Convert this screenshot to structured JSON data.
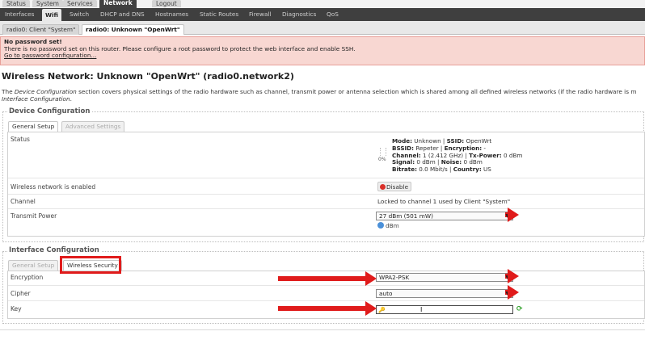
{
  "top_nav": [
    "Status",
    "System",
    "Services",
    "Network",
    "Logout"
  ],
  "sub_nav": [
    "Interfaces",
    "Wifi",
    "Switch",
    "DHCP and DNS",
    "Hostnames",
    "Static Routes",
    "Firewall",
    "Diagnostics",
    "QoS"
  ],
  "iface_tabs": [
    "radio0: Client \"System\"",
    "radio0: Unknown \"OpenWrt\""
  ],
  "alert": {
    "title": "No password set!",
    "message": "There is no password set on this router. Please configure a root password to protect the web interface and enable SSH.",
    "link": "Go to password configuration..."
  },
  "heading": "Wireless Network: Unknown \"OpenWrt\" (radio0.network2)",
  "description": {
    "prefix": "The ",
    "em1": "Device Configuration",
    "middle": " section covers physical settings of the radio hardware such as channel, transmit power or antenna selection which is shared among all defined wireless networks (if the radio hardware is m",
    "em2": "Interface Configuration",
    "suffix": "."
  },
  "device_config": {
    "legend": "Device Configuration",
    "tabs": [
      "General Setup",
      "Advanced Settings"
    ],
    "status_label": "Status",
    "signal_pct": "0%",
    "status": {
      "mode_k": "Mode:",
      "mode_v": " Unknown | ",
      "ssid_k": "SSID:",
      "ssid_v": " OpenWrt",
      "bssid_k": "BSSID:",
      "bssid_v": " Repeter | ",
      "enc_k": "Encryption:",
      "enc_v": " -",
      "chan_k": "Channel:",
      "chan_v": " 1 (2.412 GHz) | ",
      "tx_k": "Tx-Power:",
      "tx_v": " 0 dBm",
      "sig_k": "Signal:",
      "sig_v": " 0 dBm | ",
      "noise_k": "Noise:",
      "noise_v": " 0 dBm",
      "bit_k": "Bitrate:",
      "bit_v": " 0.0 Mbit/s | ",
      "country_k": "Country:",
      "country_v": " US"
    },
    "enabled_label": "Wireless network is enabled",
    "disable_button": "Disable",
    "channel_label": "Channel",
    "channel_value": "Locked to channel 1 used by Client \"System\"",
    "tx_label": "Transmit Power",
    "tx_value": "27 dBm (501 mW)",
    "tx_hint": "dBm"
  },
  "iface_config": {
    "legend": "Interface Configuration",
    "tabs": [
      "General Setup",
      "Wireless Security"
    ],
    "encryption_label": "Encryption",
    "encryption_value": "WPA2-PSK",
    "cipher_label": "Cipher",
    "cipher_value": "auto",
    "key_label": "Key"
  },
  "colors": {
    "highlight_red": "#e01b1b",
    "nav_dark": "#3f3f3f",
    "alert_bg": "#f8d7d2"
  }
}
